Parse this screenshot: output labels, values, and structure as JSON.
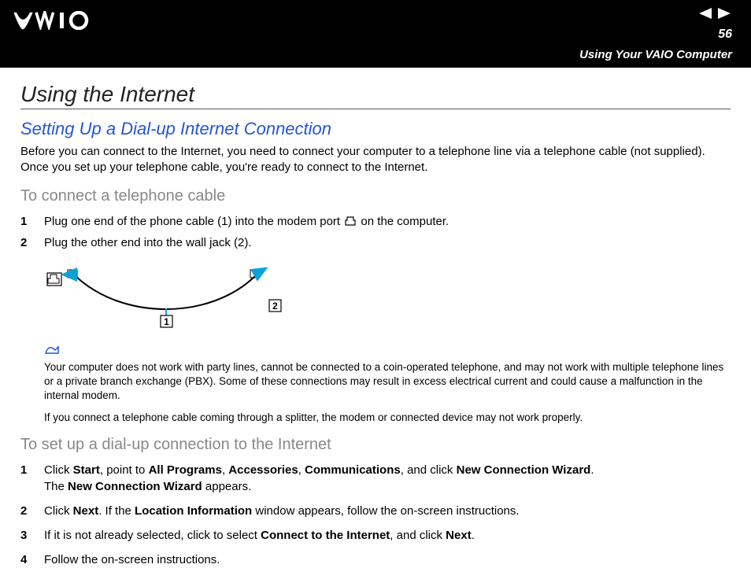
{
  "header": {
    "page_number": "56",
    "section_label": "Using Your VAIO Computer"
  },
  "content": {
    "h1": "Using the Internet",
    "h2": "Setting Up a Dial-up Internet Connection",
    "intro": "Before you can connect to the Internet, you need to connect your computer to a telephone line via a telephone cable (not supplied). Once you set up your telephone cable, you're ready to connect to the Internet.",
    "h3a": "To connect a telephone cable",
    "steps_a": [
      {
        "num": "1",
        "pre": "Plug one end of the phone cable (1) into the modem port ",
        "post": " on the computer."
      },
      {
        "num": "2",
        "pre": "Plug the other end into the wall jack (2).",
        "post": ""
      }
    ],
    "diagram": {
      "label1": "1",
      "label2": "2"
    },
    "note1": "Your computer does not work with party lines, cannot be connected to a coin-operated telephone, and may not work with multiple telephone lines or a private branch exchange (PBX). Some of these connections may result in excess electrical current and could cause a malfunction in the internal modem.",
    "note2": "If you connect a telephone cable coming through a splitter, the modem or connected device may not work properly.",
    "h3b": "To set up a dial-up connection to the Internet",
    "steps_b": [
      {
        "num": "1",
        "segments": [
          {
            "t": "Click "
          },
          {
            "b": "Start"
          },
          {
            "t": ", point to "
          },
          {
            "b": "All Programs"
          },
          {
            "t": ", "
          },
          {
            "b": "Accessories"
          },
          {
            "t": ", "
          },
          {
            "b": "Communications"
          },
          {
            "t": ", and click "
          },
          {
            "b": "New Connection Wizard"
          },
          {
            "t": "."
          }
        ],
        "line2": [
          {
            "t": "The "
          },
          {
            "b": "New Connection Wizard"
          },
          {
            "t": " appears."
          }
        ]
      },
      {
        "num": "2",
        "segments": [
          {
            "t": "Click "
          },
          {
            "b": "Next"
          },
          {
            "t": ". If the "
          },
          {
            "b": "Location Information"
          },
          {
            "t": " window appears, follow the on-screen instructions."
          }
        ]
      },
      {
        "num": "3",
        "segments": [
          {
            "t": "If it is not already selected, click to select "
          },
          {
            "b": "Connect to the Internet"
          },
          {
            "t": ", and click "
          },
          {
            "b": "Next"
          },
          {
            "t": "."
          }
        ]
      },
      {
        "num": "4",
        "segments": [
          {
            "t": "Follow the on-screen instructions."
          }
        ]
      }
    ]
  }
}
